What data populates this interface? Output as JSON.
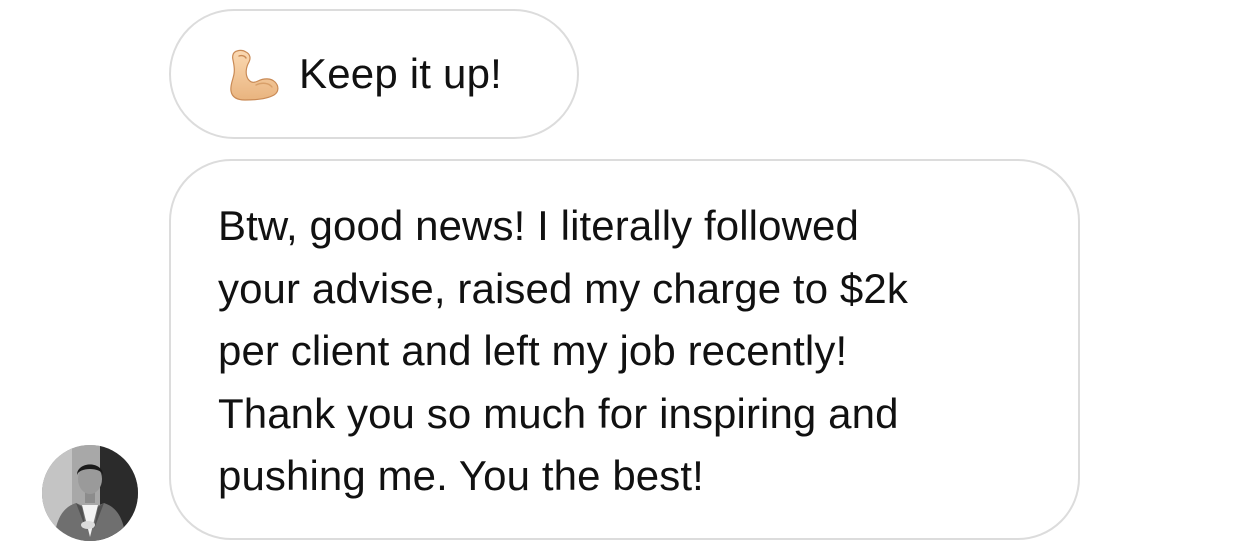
{
  "thread": {
    "messages": [
      {
        "emoji": "flexed-biceps",
        "text": "Keep it up!"
      },
      {
        "lines": [
          "Btw, good news! I literally followed",
          "your advise, raised my charge to $2k",
          "per client and left my job recently!",
          "Thank you so much for inspiring and",
          "pushing me. You the best!"
        ]
      }
    ],
    "sender_avatar": "profile-photo"
  },
  "colors": {
    "bubble_border": "#dcdcdc",
    "text": "#111111",
    "background": "#ffffff",
    "emoji_skin": "#f5c89a"
  }
}
